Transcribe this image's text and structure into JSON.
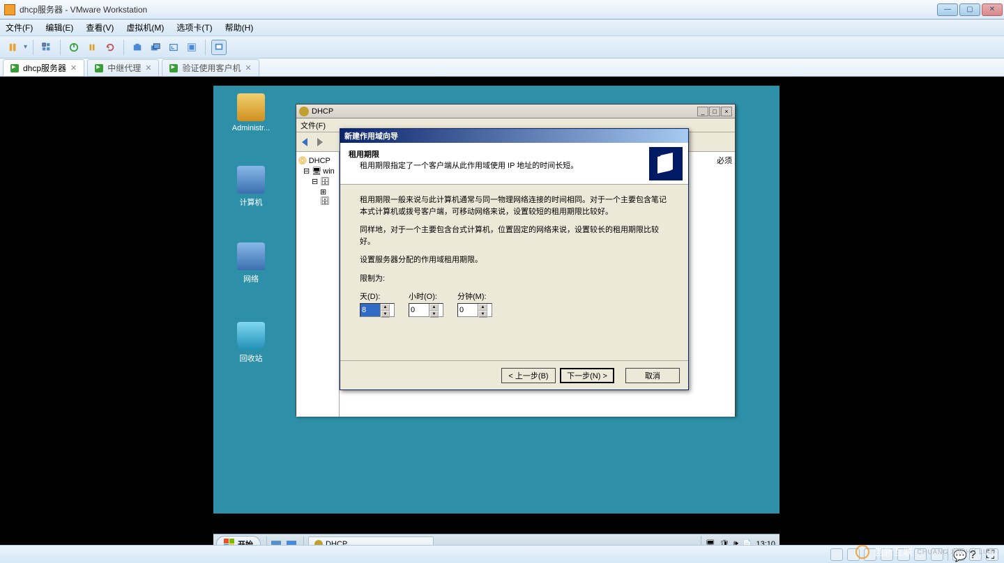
{
  "vmware": {
    "title": "dhcp服务器 - VMware Workstation",
    "menu": [
      "文件(F)",
      "编辑(E)",
      "查看(V)",
      "虚拟机(M)",
      "选项卡(T)",
      "帮助(H)"
    ],
    "tabs": [
      {
        "label": "dhcp服务器",
        "active": true
      },
      {
        "label": "中继代理",
        "active": false
      },
      {
        "label": "验证使用客户机",
        "active": false
      }
    ]
  },
  "desktop_icons": [
    {
      "label": "Administr...",
      "color": "#e8c060"
    },
    {
      "label": "计算机",
      "color": "#4a8ad4"
    },
    {
      "label": "网络",
      "color": "#4a8ad4"
    },
    {
      "label": "回收站",
      "color": "#4ac4e8"
    }
  ],
  "mmc": {
    "title": "DHCP",
    "menu": [
      "文件(F)"
    ],
    "tree": [
      "DHCP",
      "win"
    ],
    "content_hint": "必须"
  },
  "wizard": {
    "title": "新建作用域向导",
    "header_title": "租用期限",
    "header_sub": "租用期限指定了一个客户端从此作用域使用 IP 地址的时间长短。",
    "para1": "租用期限一般来说与此计算机通常与同一物理网络连接的时间相同。对于一个主要包含笔记本式计算机或拨号客户端，可移动网络来说，设置较短的租用期限比较好。",
    "para2": "同样地，对于一个主要包含台式计算机，位置固定的网络来说，设置较长的租用期限比较好。",
    "para3": "设置服务器分配的作用域租用期限。",
    "limit_label": "限制为:",
    "fields": {
      "days": {
        "label": "天(D):",
        "value": "8"
      },
      "hours": {
        "label": "小时(O):",
        "value": "0"
      },
      "minutes": {
        "label": "分钟(M):",
        "value": "0"
      }
    },
    "buttons": {
      "back": "< 上一步(B)",
      "next": "下一步(N) >",
      "cancel": "取消"
    }
  },
  "taskbar": {
    "start": "开始",
    "app": "DHCP",
    "time": "13:10"
  },
  "watermark": "创新互联"
}
